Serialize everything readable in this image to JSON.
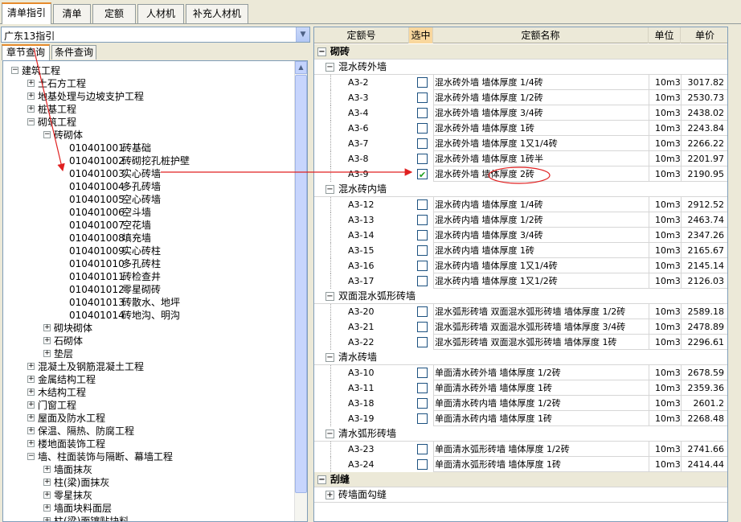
{
  "top_tabs": [
    "清单指引",
    "清单",
    "定额",
    "人材机",
    "补充人材机"
  ],
  "combo_value": "广东13指引",
  "sub_tabs": [
    "章节查询",
    "条件查询"
  ],
  "tree": [
    {
      "lvl": 0,
      "pm": "−",
      "label": "建筑工程"
    },
    {
      "lvl": 1,
      "pm": "+",
      "label": "土石方工程"
    },
    {
      "lvl": 1,
      "pm": "+",
      "label": "地基处理与边坡支护工程"
    },
    {
      "lvl": 1,
      "pm": "+",
      "label": "桩基工程"
    },
    {
      "lvl": 1,
      "pm": "−",
      "label": "砌筑工程"
    },
    {
      "lvl": 2,
      "pm": "−",
      "label": "砖砌体"
    },
    {
      "lvl": 3,
      "code": "010401001",
      "name": "砖基础"
    },
    {
      "lvl": 3,
      "code": "010401002",
      "name": "砖砌挖孔桩护壁"
    },
    {
      "lvl": 3,
      "code": "010401003",
      "name": "实心砖墙",
      "sel": true
    },
    {
      "lvl": 3,
      "code": "010401004",
      "name": "多孔砖墙"
    },
    {
      "lvl": 3,
      "code": "010401005",
      "name": "空心砖墙"
    },
    {
      "lvl": 3,
      "code": "010401006",
      "name": "空斗墙"
    },
    {
      "lvl": 3,
      "code": "010401007",
      "name": "空花墙"
    },
    {
      "lvl": 3,
      "code": "010401008",
      "name": "填充墙"
    },
    {
      "lvl": 3,
      "code": "010401009",
      "name": "实心砖柱"
    },
    {
      "lvl": 3,
      "code": "010401010",
      "name": "多孔砖柱"
    },
    {
      "lvl": 3,
      "code": "010401011",
      "name": "砖检查井"
    },
    {
      "lvl": 3,
      "code": "010401012",
      "name": "零星砌砖"
    },
    {
      "lvl": 3,
      "code": "010401013",
      "name": "砖散水、地坪"
    },
    {
      "lvl": 3,
      "code": "010401014",
      "name": "砖地沟、明沟"
    },
    {
      "lvl": 2,
      "pm": "+",
      "label": "砌块砌体"
    },
    {
      "lvl": 2,
      "pm": "+",
      "label": "石砌体"
    },
    {
      "lvl": 2,
      "pm": "+",
      "label": "垫层"
    },
    {
      "lvl": 1,
      "pm": "+",
      "label": "混凝土及钢筋混凝土工程"
    },
    {
      "lvl": 1,
      "pm": "+",
      "label": "金属结构工程"
    },
    {
      "lvl": 1,
      "pm": "+",
      "label": "木结构工程"
    },
    {
      "lvl": 1,
      "pm": "+",
      "label": "门窗工程"
    },
    {
      "lvl": 1,
      "pm": "+",
      "label": "屋面及防水工程"
    },
    {
      "lvl": 1,
      "pm": "+",
      "label": "保温、隔热、防腐工程"
    },
    {
      "lvl": 1,
      "pm": "+",
      "label": "楼地面装饰工程"
    },
    {
      "lvl": 1,
      "pm": "−",
      "label": "墙、柱面装饰与隔断、幕墙工程"
    },
    {
      "lvl": 2,
      "pm": "+",
      "label": "墙面抹灰"
    },
    {
      "lvl": 2,
      "pm": "+",
      "label": "柱(梁)面抹灰"
    },
    {
      "lvl": 2,
      "pm": "+",
      "label": "零星抹灰"
    },
    {
      "lvl": 2,
      "pm": "+",
      "label": "墙面块料面层"
    },
    {
      "lvl": 2,
      "pm": "+",
      "label": "柱(梁)面镶贴块料"
    }
  ],
  "grid_headers": [
    "定额号",
    "选中",
    "定额名称",
    "单位",
    "单价"
  ],
  "grid": [
    {
      "t": "g0",
      "pm": "−",
      "label": "砌砖"
    },
    {
      "t": "g1",
      "pm": "−",
      "label": "混水砖外墙"
    },
    {
      "t": "r",
      "code": "A3-2",
      "name": "混水砖外墙 墙体厚度 1/4砖",
      "unit": "10m3",
      "price": "3017.82"
    },
    {
      "t": "r",
      "code": "A3-3",
      "name": "混水砖外墙 墙体厚度 1/2砖",
      "unit": "10m3",
      "price": "2530.73"
    },
    {
      "t": "r",
      "code": "A3-4",
      "name": "混水砖外墙 墙体厚度 3/4砖",
      "unit": "10m3",
      "price": "2438.02"
    },
    {
      "t": "r",
      "code": "A3-6",
      "name": "混水砖外墙 墙体厚度 1砖",
      "unit": "10m3",
      "price": "2243.84"
    },
    {
      "t": "r",
      "code": "A3-7",
      "name": "混水砖外墙 墙体厚度 1又1/4砖",
      "unit": "10m3",
      "price": "2266.22"
    },
    {
      "t": "r",
      "code": "A3-8",
      "name": "混水砖外墙 墙体厚度 1砖半",
      "unit": "10m3",
      "price": "2201.97"
    },
    {
      "t": "r",
      "code": "A3-9",
      "name": "混水砖外墙 墙体厚度 2砖",
      "unit": "10m3",
      "price": "2190.95",
      "checked": true
    },
    {
      "t": "g1",
      "pm": "−",
      "label": "混水砖内墙"
    },
    {
      "t": "r",
      "code": "A3-12",
      "name": "混水砖内墙 墙体厚度 1/4砖",
      "unit": "10m3",
      "price": "2912.52"
    },
    {
      "t": "r",
      "code": "A3-13",
      "name": "混水砖内墙 墙体厚度 1/2砖",
      "unit": "10m3",
      "price": "2463.74"
    },
    {
      "t": "r",
      "code": "A3-14",
      "name": "混水砖内墙 墙体厚度 3/4砖",
      "unit": "10m3",
      "price": "2347.26"
    },
    {
      "t": "r",
      "code": "A3-15",
      "name": "混水砖内墙 墙体厚度 1砖",
      "unit": "10m3",
      "price": "2165.67"
    },
    {
      "t": "r",
      "code": "A3-16",
      "name": "混水砖内墙 墙体厚度 1又1/4砖",
      "unit": "10m3",
      "price": "2145.14"
    },
    {
      "t": "r",
      "code": "A3-17",
      "name": "混水砖内墙 墙体厚度 1又1/2砖",
      "unit": "10m3",
      "price": "2126.03"
    },
    {
      "t": "g1",
      "pm": "−",
      "label": "双面混水弧形砖墙"
    },
    {
      "t": "r",
      "code": "A3-20",
      "name": "混水弧形砖墙 双面混水弧形砖墙 墙体厚度 1/2砖",
      "unit": "10m3",
      "price": "2589.18"
    },
    {
      "t": "r",
      "code": "A3-21",
      "name": "混水弧形砖墙 双面混水弧形砖墙 墙体厚度 3/4砖",
      "unit": "10m3",
      "price": "2478.89"
    },
    {
      "t": "r",
      "code": "A3-22",
      "name": "混水弧形砖墙 双面混水弧形砖墙 墙体厚度 1砖",
      "unit": "10m3",
      "price": "2296.61"
    },
    {
      "t": "g1",
      "pm": "−",
      "label": "清水砖墙"
    },
    {
      "t": "r",
      "code": "A3-10",
      "name": "单面清水砖外墙 墙体厚度 1/2砖",
      "unit": "10m3",
      "price": "2678.59"
    },
    {
      "t": "r",
      "code": "A3-11",
      "name": "单面清水砖外墙 墙体厚度 1砖",
      "unit": "10m3",
      "price": "2359.36"
    },
    {
      "t": "r",
      "code": "A3-18",
      "name": "单面清水砖内墙 墙体厚度 1/2砖",
      "unit": "10m3",
      "price": "2601.2"
    },
    {
      "t": "r",
      "code": "A3-19",
      "name": "单面清水砖内墙 墙体厚度 1砖",
      "unit": "10m3",
      "price": "2268.48"
    },
    {
      "t": "g1",
      "pm": "−",
      "label": "清水弧形砖墙"
    },
    {
      "t": "r",
      "code": "A3-23",
      "name": "单面清水弧形砖墙 墙体厚度 1/2砖",
      "unit": "10m3",
      "price": "2741.66"
    },
    {
      "t": "r",
      "code": "A3-24",
      "name": "单面清水弧形砖墙 墙体厚度 1砖",
      "unit": "10m3",
      "price": "2414.44"
    },
    {
      "t": "g0",
      "pm": "−",
      "label": "刮缝"
    },
    {
      "t": "g1",
      "pm": "+",
      "label": "砖墙面勾缝"
    }
  ],
  "colors": {
    "annotation": "#e02020",
    "tab_accent": "#e68b2c",
    "check": "#21a121"
  }
}
